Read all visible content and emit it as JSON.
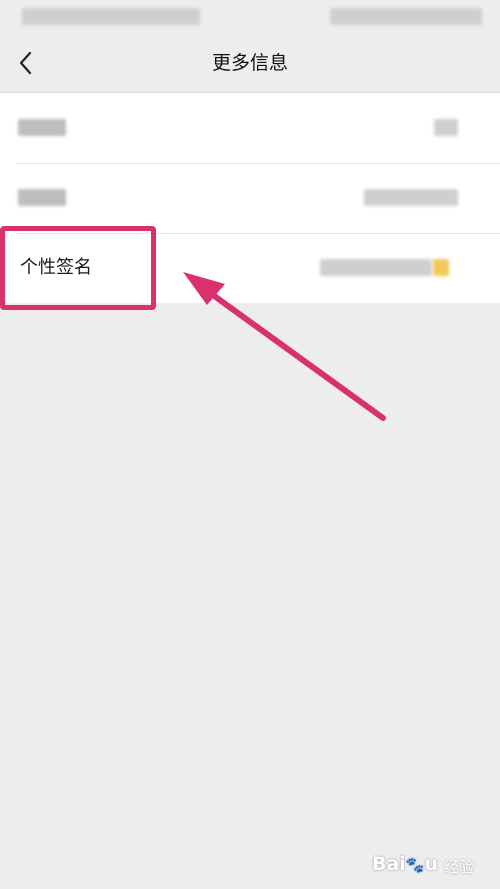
{
  "nav": {
    "title": "更多信息"
  },
  "rows": [
    {
      "label": ""
    },
    {
      "label": ""
    },
    {
      "label": "个性签名"
    }
  ],
  "watermark": {
    "logo_left": "Bai",
    "logo_right": "u",
    "text": "经验"
  },
  "colors": {
    "highlight": "#d9306e",
    "background": "#ededed",
    "card": "#ffffff"
  }
}
